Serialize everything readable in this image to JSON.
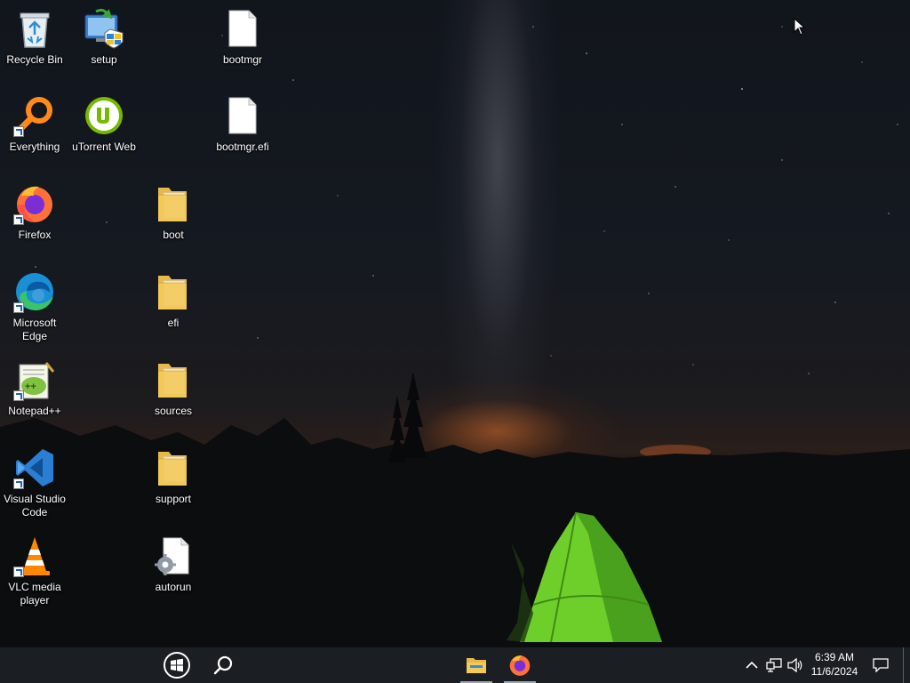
{
  "desktop": {
    "icons": [
      {
        "label": "Recycle Bin"
      },
      {
        "label": "setup"
      },
      {
        "label": "bootmgr"
      },
      {
        "label": "Everything"
      },
      {
        "label": "uTorrent Web"
      },
      {
        "label": "bootmgr.efi"
      },
      {
        "label": "Firefox"
      },
      {
        "label": "boot"
      },
      {
        "label": "Microsoft Edge"
      },
      {
        "label": "efi"
      },
      {
        "label": "Notepad++"
      },
      {
        "label": "sources"
      },
      {
        "label": "Visual Studio Code"
      },
      {
        "label": "support"
      },
      {
        "label": "VLC media player"
      },
      {
        "label": "autorun"
      }
    ]
  },
  "taskbar": {
    "time": "6:39 AM",
    "date": "11/6/2024"
  },
  "colors": {
    "taskbar_bg": "#1b1e22",
    "folder_yellow": "#f3c95a",
    "firefox_orange": "#ff7139",
    "edge_blue": "#1a8fd6",
    "vscode_blue": "#2a7fd4",
    "utorrent_green": "#76b900",
    "tent_green": "#6fcf2a"
  }
}
